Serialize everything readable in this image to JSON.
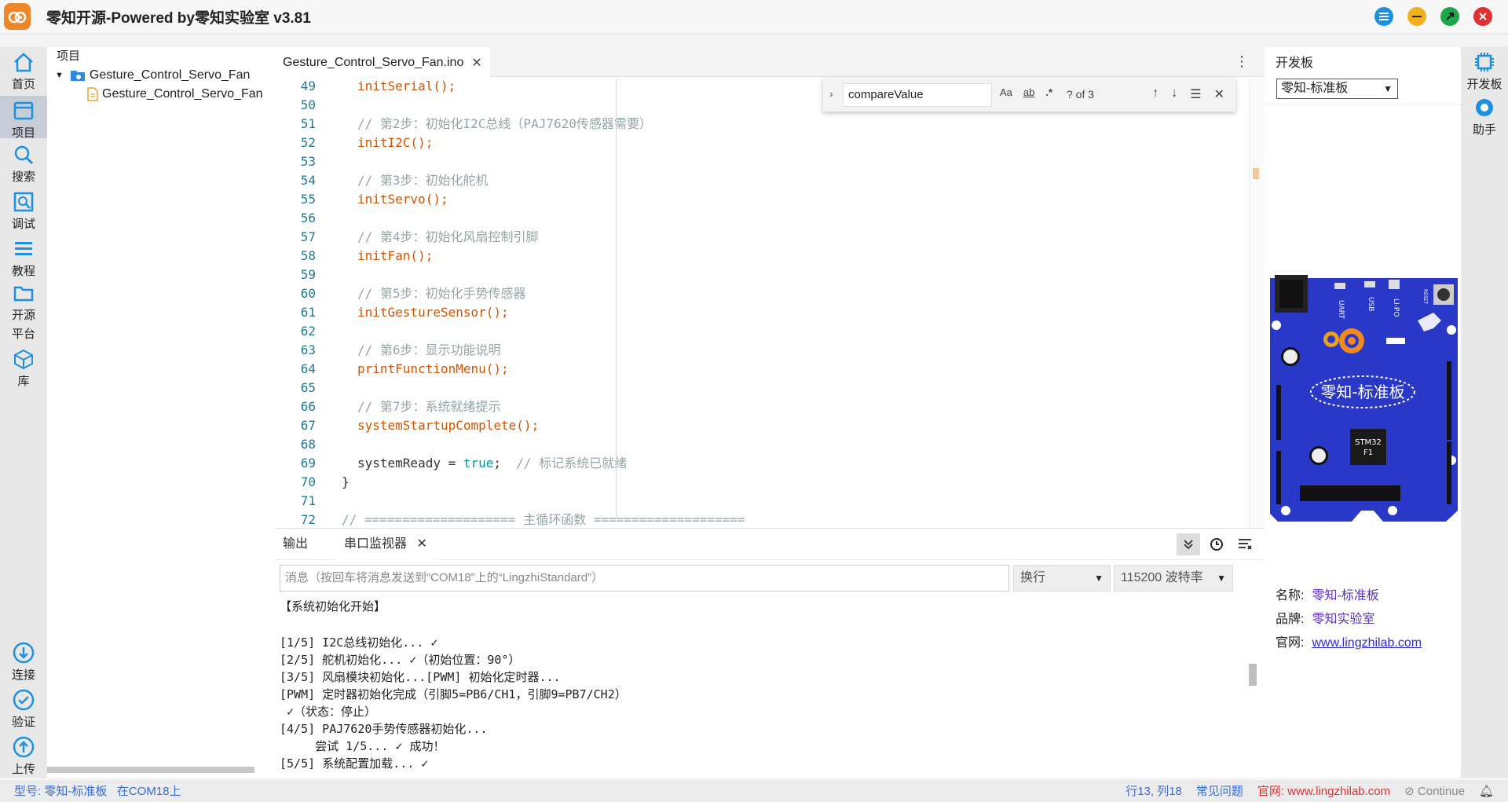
{
  "window": {
    "title": "零知开源-Powered by零知实验室 v3.81",
    "buttons": [
      "menu-icon",
      "minimize-icon",
      "maximize-icon",
      "close-icon"
    ]
  },
  "activity_bar": {
    "items": [
      {
        "label": "首页",
        "icon": "home-icon"
      },
      {
        "label": "项目",
        "icon": "project-icon",
        "active": true
      },
      {
        "label": "搜索",
        "icon": "search-icon"
      },
      {
        "label": "调试",
        "icon": "debug-icon"
      },
      {
        "label": "教程",
        "icon": "tutorial-icon"
      },
      {
        "label": "开源\n平台",
        "icon": "folder-icon"
      },
      {
        "label": "库",
        "icon": "library-icon"
      }
    ],
    "bottom_items": [
      {
        "label": "连接",
        "icon": "connect-icon"
      },
      {
        "label": "验证",
        "icon": "verify-icon"
      },
      {
        "label": "上传",
        "icon": "upload-icon"
      }
    ]
  },
  "explorer": {
    "header": "项目",
    "folder": "Gesture_Control_Servo_Fan",
    "file": "Gesture_Control_Servo_Fan"
  },
  "editor": {
    "tab_label": "Gesture_Control_Servo_Fan.ino",
    "lines": [
      {
        "n": "49",
        "code": "initSerial();",
        "type": "call"
      },
      {
        "n": "50",
        "code": "",
        "type": "blank"
      },
      {
        "n": "51",
        "code": "// 第2步：初始化I2C总线（PAJ7620传感器需要）",
        "type": "comment"
      },
      {
        "n": "52",
        "code": "initI2C();",
        "type": "call"
      },
      {
        "n": "53",
        "code": "",
        "type": "blank"
      },
      {
        "n": "54",
        "code": "// 第3步：初始化舵机",
        "type": "comment"
      },
      {
        "n": "55",
        "code": "initServo();",
        "type": "call"
      },
      {
        "n": "56",
        "code": "",
        "type": "blank"
      },
      {
        "n": "57",
        "code": "// 第4步：初始化风扇控制引脚",
        "type": "comment"
      },
      {
        "n": "58",
        "code": "initFan();",
        "type": "call"
      },
      {
        "n": "59",
        "code": "",
        "type": "blank"
      },
      {
        "n": "60",
        "code": "// 第5步：初始化手势传感器",
        "type": "comment"
      },
      {
        "n": "61",
        "code": "initGestureSensor();",
        "type": "call"
      },
      {
        "n": "62",
        "code": "",
        "type": "blank"
      },
      {
        "n": "63",
        "code": "// 第6步：显示功能说明",
        "type": "comment"
      },
      {
        "n": "64",
        "code": "printFunctionMenu();",
        "type": "call"
      },
      {
        "n": "65",
        "code": "",
        "type": "blank"
      },
      {
        "n": "66",
        "code": "// 第7步：系统就绪提示",
        "type": "comment"
      },
      {
        "n": "67",
        "code": "systemStartupComplete();",
        "type": "call"
      },
      {
        "n": "68",
        "code": "",
        "type": "blank"
      },
      {
        "n": "69",
        "code": "systemReady = true;  // 标记系统已就绪",
        "type": "assign"
      },
      {
        "n": "70",
        "code": "}",
        "type": "brace"
      },
      {
        "n": "71",
        "code": "",
        "type": "blank"
      },
      {
        "n": "72",
        "code": "// ==================== 主循环函数 ====================",
        "type": "comment_top"
      }
    ]
  },
  "find_widget": {
    "value": "compareValue",
    "opt_case": "Aa",
    "opt_word": "ab",
    "opt_regex": ".*",
    "count": "? of 3"
  },
  "panel": {
    "tab_output": "输出",
    "tab_serial": "串口监视器",
    "message_placeholder": "消息（按回车将消息发送到“COM18”上的“LingzhiStandard”）",
    "line_ending": "换行",
    "baud_rate": "115200 波特率",
    "console_lines": [
      "【系统初始化开始】",
      "",
      "[1/5] I2C总线初始化... ✓",
      "[2/5] 舵机初始化... ✓（初始位置：90°）",
      "[3/5] 风扇模块初始化...[PWM] 初始化定时器...",
      "[PWM] 定时器初始化完成（引脚5=PB6/CH1，引脚9=PB7/CH2）",
      " ✓（状态：停止）",
      "[4/5] PAJ7620手势传感器初始化...",
      "     尝试 1/5... ✓ 成功！",
      "[5/5] 系统配置加载... ✓"
    ]
  },
  "board_panel": {
    "title": "开发板",
    "selected_board": "零知-标准板",
    "board_label": "零知-标准板",
    "chip_label_1": "STM32",
    "chip_label_2": "F1",
    "silk_uart": "UART",
    "silk_usb": "USB",
    "silk_lipo": "LI-PO",
    "silk_reset": "RESET",
    "info": [
      {
        "key": "名称:",
        "value": "零知-标准板"
      },
      {
        "key": "品牌:",
        "value": "零知实验室"
      },
      {
        "key": "官网:",
        "value": "www.lingzhilab.com"
      }
    ]
  },
  "right_bar": {
    "items": [
      {
        "label": "开发板",
        "icon": "board-icon"
      },
      {
        "label": "助手",
        "icon": "assistant-icon"
      }
    ]
  },
  "status_bar": {
    "left": "型号: 零知-标准板   在COM18上",
    "position": "行13, 列18",
    "problems": "常见问题",
    "website": "官网: www.lingzhilab.com",
    "continue": "Continue"
  },
  "colors": {
    "function": "#d35400",
    "comment": "#95a5a6",
    "keyword": "#00979c",
    "board_blue": "#2a38c8",
    "link": "#5b2fc8"
  }
}
